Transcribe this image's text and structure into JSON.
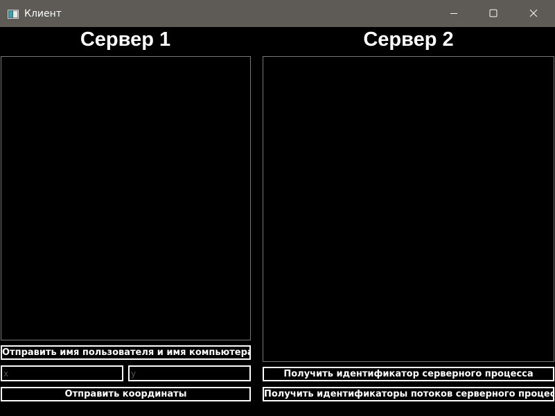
{
  "window": {
    "title": "Клиент",
    "icon": "app-window-icon",
    "controls": {
      "minimize_icon": "minimize-icon",
      "maximize_icon": "maximize-icon",
      "close_icon": "close-icon"
    }
  },
  "server1": {
    "title": "Сервер 1",
    "output_text": "",
    "send_user_button": "Отправить имя пользователя и имя компьютера",
    "x_input": {
      "value": "",
      "placeholder": "x"
    },
    "y_input": {
      "value": "",
      "placeholder": "y"
    },
    "send_coords_button": "Отправить координаты"
  },
  "server2": {
    "title": "Сервер 2",
    "output_text": "",
    "get_pid_button": "Получить идентификатор серверного процесса",
    "get_tids_button": "Получить идентификаторы потоков серверного процесса"
  },
  "colors": {
    "background": "#000000",
    "titlebar": "#5e5a55",
    "text": "#ffffff",
    "border": "#7a7a7a"
  }
}
